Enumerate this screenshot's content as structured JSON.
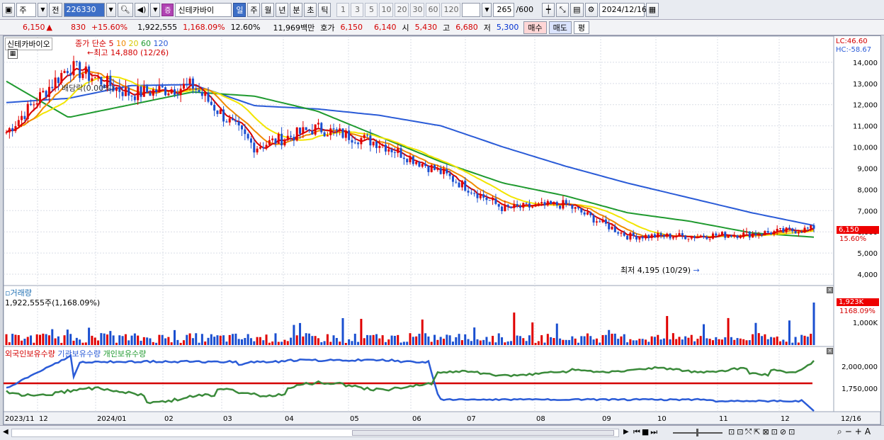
{
  "toolbar": {
    "period_selected": "주",
    "prev_label": "전",
    "code": "226330",
    "market_badge": "증",
    "stock_name": "신테카바이",
    "periods": [
      "일",
      "주",
      "월",
      "년",
      "분",
      "초",
      "틱"
    ],
    "period_active": "일",
    "numbers": [
      "1",
      "3",
      "5",
      "10",
      "20",
      "30",
      "60",
      "120"
    ],
    "count": "265",
    "count_total": "/600",
    "date": "2024/12/16"
  },
  "quote": {
    "price": "6,150",
    "change": "830",
    "change_pct": "+15.60%",
    "volume": "1,922,555",
    "volume_pct": "1,168.09%",
    "turnover": "12.60%",
    "amount": "11,969백만",
    "hoga_label": "호가",
    "ask": "6,150",
    "bid": "6,140",
    "open_label": "시",
    "open": "5,430",
    "high_label": "고",
    "high": "6,680",
    "low_label": "저",
    "low": "5,300",
    "buy_label": "매수",
    "sell_label": "매도",
    "avg_label": "평"
  },
  "price_pane": {
    "name": "신테카바이오",
    "ma_label": "종가 단순",
    "ma_periods": [
      "5",
      "10",
      "20",
      "60",
      "120"
    ],
    "ma_colors": [
      "#d40000",
      "#f08a00",
      "#f2e500",
      "#1f9a2f",
      "#2a5bd7"
    ],
    "max_label": "최고 14,880 (12/26)",
    "min_label": "최저 4,195 (10/29)",
    "dividend_label": "배당락(0.00%)",
    "lc_label": "LC:46.60",
    "hc_label": "HC:-58.67",
    "current_price_tag": "6,150",
    "current_pct_tag": "15.60%",
    "y_ticks": [
      "14,000",
      "13,000",
      "12,000",
      "11,000",
      "10,000",
      "9,000",
      "8,000",
      "7,000",
      "6,000",
      "5,000",
      "4,000"
    ]
  },
  "volume_pane": {
    "title": "거래량",
    "value_label": "1,922,555주(1,168.09%)",
    "tag_value": "1,923K",
    "tag_pct": "1168.09%",
    "y_tick": "1,000K"
  },
  "holding_pane": {
    "legend": [
      "외국인보유수량",
      "기관보유수량",
      "개인보유수량"
    ],
    "y_ticks": [
      "2,000,000",
      "1,750,000"
    ]
  },
  "x_axis": {
    "labels": [
      "2023/11",
      "12",
      "2024/01",
      "02",
      "03",
      "04",
      "05",
      "06",
      "07",
      "08",
      "09",
      "10",
      "11",
      "12",
      "12/16"
    ]
  },
  "chart_data": {
    "type": "candlestick",
    "title": "",
    "ylabel": "",
    "price_ylim": [
      3700,
      14900
    ],
    "monthly_points": [
      {
        "month": "2023/11",
        "ma120": 12100,
        "ma60": 13100,
        "close": 10700
      },
      {
        "month": "2023/12",
        "ma120": 12300,
        "ma60": 11400,
        "close": 13800
      },
      {
        "month": "2024/01",
        "ma120": 12900,
        "ma60": 12000,
        "close": 12500
      },
      {
        "month": "2024/02",
        "ma120": 12950,
        "ma60": 12600,
        "close": 12900
      },
      {
        "month": "2024/03",
        "ma120": 11950,
        "ma60": 12400,
        "close": 10000
      },
      {
        "month": "2024/04",
        "ma120": 11800,
        "ma60": 11700,
        "close": 10900
      },
      {
        "month": "2024/05",
        "ma120": 11500,
        "ma60": 10500,
        "close": 10200
      },
      {
        "month": "2024/06",
        "ma120": 11000,
        "ma60": 9300,
        "close": 8800
      },
      {
        "month": "2024/07",
        "ma120": 10000,
        "ma60": 8300,
        "close": 7100
      },
      {
        "month": "2024/08",
        "ma120": 9100,
        "ma60": 7700,
        "close": 7300
      },
      {
        "month": "2024/09",
        "ma120": 8300,
        "ma60": 6900,
        "close": 5800
      },
      {
        "month": "2024/10",
        "ma120": 7600,
        "ma60": 6500,
        "close": 5800
      },
      {
        "month": "2024/11",
        "ma120": 6900,
        "ma60": 5950,
        "close": 5900
      },
      {
        "month": "2024/12",
        "ma120": 6300,
        "ma60": 5750,
        "close": 6150
      }
    ],
    "extremes": {
      "max": 14880,
      "max_date": "12/26",
      "min": 4195,
      "min_date": "10/29"
    },
    "last": {
      "price": 6150,
      "volume": 1922555,
      "volume_pct": 1168.09
    }
  }
}
